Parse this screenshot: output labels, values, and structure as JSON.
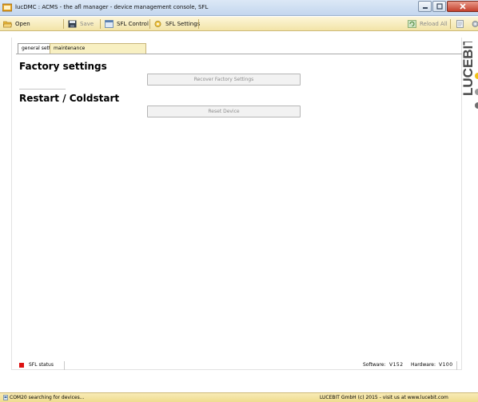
{
  "window": {
    "title": "lucDMC : ACMS - the afl manager - device management console, SFL"
  },
  "toolbar": {
    "open_label": "Open",
    "save_label": "Save",
    "sfl_control_label": "SFL Control",
    "sfl_settings_label": "SFL Settings",
    "reload_all_label": "Reload All"
  },
  "tabs": [
    {
      "label": "general settings"
    },
    {
      "label": "maintenance"
    }
  ],
  "maintenance": {
    "factory_title": "Factory settings",
    "recover_button": "Recover Factory Settings",
    "restart_title": "Restart / Coldstart",
    "reset_button": "Reset Device"
  },
  "brand": {
    "name": "LUCEBIT"
  },
  "status": {
    "sfl_status_label": "SFL status",
    "software_label": "Software:",
    "software_value": "V152",
    "hardware_label": "Hardware:",
    "hardware_value": "V100"
  },
  "footer": {
    "com_text": "COM20   searching for devices...",
    "copyright": "LUCEBIT GmbH (c) 2015 - visit us at www.lucebit.com"
  },
  "colors": {
    "toolbar_bg": "#f2e4a8",
    "tab_active_bg": "#f8f0c2",
    "status_light": "#dd1111",
    "brand_yellow": "#f2c21b"
  }
}
